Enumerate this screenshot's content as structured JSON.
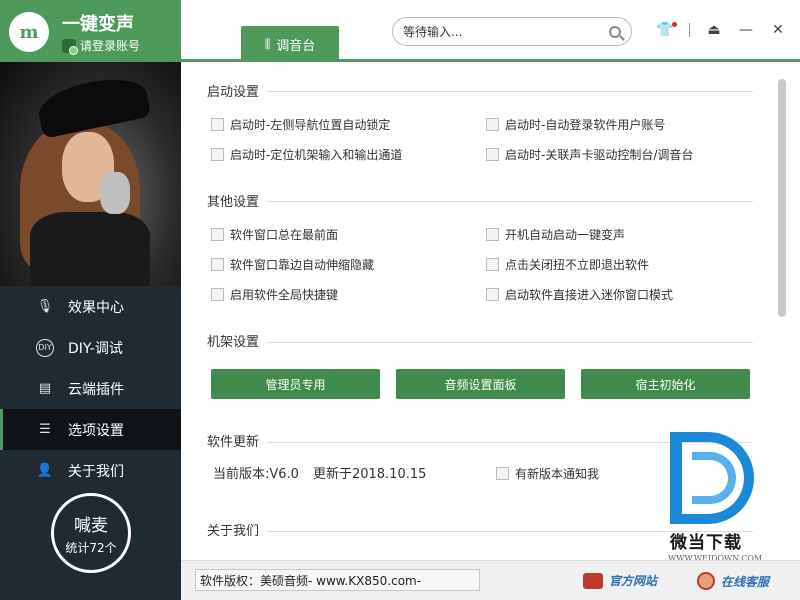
{
  "app": {
    "logo_text": "m",
    "title": "一键变声",
    "login_text": "请登录账号"
  },
  "nav": {
    "items": [
      {
        "label": "效果中心",
        "icon": "mic-icon"
      },
      {
        "label": "DIY-调试",
        "icon": "diy-icon"
      },
      {
        "label": "云端插件",
        "icon": "document-icon"
      },
      {
        "label": "选项设置",
        "icon": "sliders-icon",
        "active": true
      },
      {
        "label": "关于我们",
        "icon": "user-icon"
      }
    ]
  },
  "mic_circle": {
    "title": "喊麦",
    "count": "统计72个"
  },
  "topbar": {
    "tab_label": "调音台",
    "search_placeholder": "等待输入..."
  },
  "sections": {
    "startup": {
      "title": "启动设置",
      "options": [
        "启动时-左侧导航位置自动锁定",
        "启动时-自动登录软件用户账号",
        "启动时-定位机架输入和输出通道",
        "启动时-关联声卡驱动控制台/调音台"
      ]
    },
    "other": {
      "title": "其他设置",
      "options": [
        "软件窗口总在最前面",
        "开机自动启动一键变声",
        "软件窗口靠边自动伸缩隐藏",
        "点击关闭扭不立即退出软件",
        "启用软件全局快捷键",
        "启动软件直接进入迷你窗口模式"
      ]
    },
    "rack": {
      "title": "机架设置",
      "buttons": [
        "管理员专用",
        "音频设置面板",
        "宿主初始化"
      ]
    },
    "update": {
      "title": "软件更新",
      "current_version": "当前版本:V6.0",
      "updated": "更新于2018.10.15",
      "notify_label": "有新版本通知我"
    },
    "about": {
      "title": "关于我们"
    }
  },
  "watermark": {
    "name": "微当下载",
    "url": "WWW.WEIDOWN.COM"
  },
  "footer": {
    "copyright": "软件版权：美硕音频- www.KX850.com-",
    "official_site": "官方网站",
    "online_support": "在线客服"
  },
  "colors": {
    "accent": "#4e9a5a",
    "sidebar": "#1f2a33",
    "link": "#2d6fb5"
  }
}
